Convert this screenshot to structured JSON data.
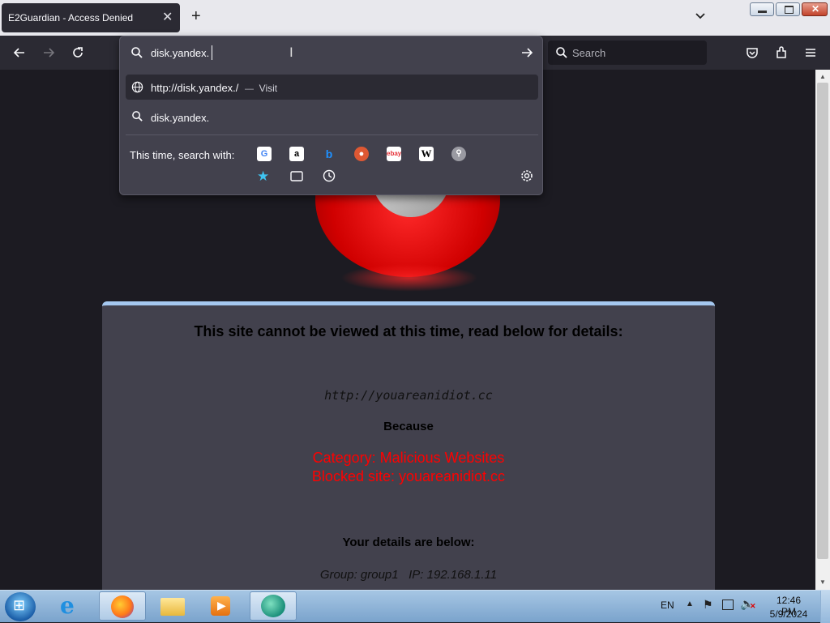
{
  "browser": {
    "tab_title": "E2Guardian - Access Denied",
    "search_placeholder": "Search"
  },
  "urlbar": {
    "input_value": "disk.yandex.",
    "suggestions": [
      {
        "icon": "globe-icon",
        "url": "http://disk.yandex./",
        "separator": "—",
        "action": "Visit"
      },
      {
        "icon": "search-icon",
        "text": "disk.yandex."
      }
    ],
    "search_with_label": "This time, search with:",
    "engines": [
      "google-icon",
      "amazon-icon",
      "bing-icon",
      "duckduckgo-icon",
      "ebay-icon",
      "wikipedia-icon",
      "search-engine-icon"
    ],
    "modes": [
      "bookmarks-icon",
      "tabs-icon",
      "history-icon"
    ]
  },
  "page": {
    "heading": "This site cannot be viewed at this time, read below for details:",
    "blocked_url": "http://youareanidiot.cc",
    "because": "Because",
    "category": "Category: Malicious Websites",
    "blocked_site": "Blocked site: youareanidiot.cc",
    "details_heading": "Your details are below:",
    "group_ip": "Group: group1   IP: 192.168.1.11"
  },
  "taskbar": {
    "language": "EN",
    "time": "12:46 PM",
    "date": "5/9/2024"
  },
  "colors": {
    "panel_bg": "#42414d",
    "panel_border": "#a5c8f0",
    "alert_red": "#ff0000",
    "chrome_dark": "#2b2a33"
  }
}
